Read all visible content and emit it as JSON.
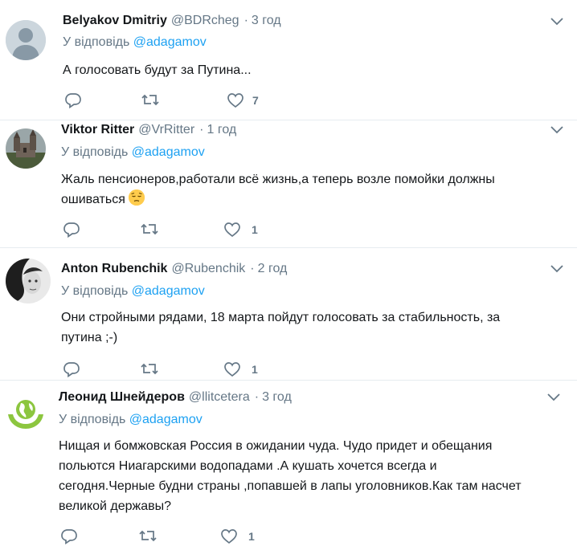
{
  "colors": {
    "link": "#1da1f2",
    "muted": "#657786",
    "text": "#14171a",
    "border": "#e6ecf0"
  },
  "replies": [
    {
      "name": "Belyakov Dmitriy",
      "handle": "@BDRcheg",
      "time": "3 год",
      "reply_prefix": "У відповідь",
      "mention": "@adagamov",
      "text_lines": [
        "А голосовать будут за Путина..."
      ],
      "emoji": "",
      "avatar": "default-avatar-icon",
      "likes": "7"
    },
    {
      "name": "Viktor Ritter",
      "handle": "@VrRitter",
      "time": "1 год",
      "reply_prefix": "У відповідь",
      "mention": "@adagamov",
      "text_lines": [
        "Жаль пенсионеров,работали всё жизнь,а теперь возле помойки должны",
        "ошиваться"
      ],
      "emoji": "pensive-face",
      "avatar": "castle-photo-avatar",
      "likes": "1"
    },
    {
      "name": "Anton Rubenchik",
      "handle": "@Rubenchik",
      "time": "2 год",
      "reply_prefix": "У відповідь",
      "mention": "@adagamov",
      "text_lines": [
        "Они стройными рядами, 18 марта пойдут голосовать за стабильность, за",
        "путина ;-)"
      ],
      "emoji": "",
      "avatar": "portrait-photo-avatar",
      "likes": "1"
    },
    {
      "name": "Леонид Шнейдеров",
      "handle": "@llitcetera",
      "time": "3 год",
      "reply_prefix": "У відповідь",
      "mention": "@adagamov",
      "text_lines": [
        "Нищая и бомжовская Россия в ожидании чуда. Чудо придет и обещания",
        "польются Ниагарскими водопадами .А кушать хочется всегда и",
        "сегодня.Черные будни страны ,попавшей в лапы уголовников.Как там насчет",
        "великой державы?"
      ],
      "emoji": "",
      "avatar": "globe-hands-logo-avatar",
      "likes": "1"
    }
  ]
}
